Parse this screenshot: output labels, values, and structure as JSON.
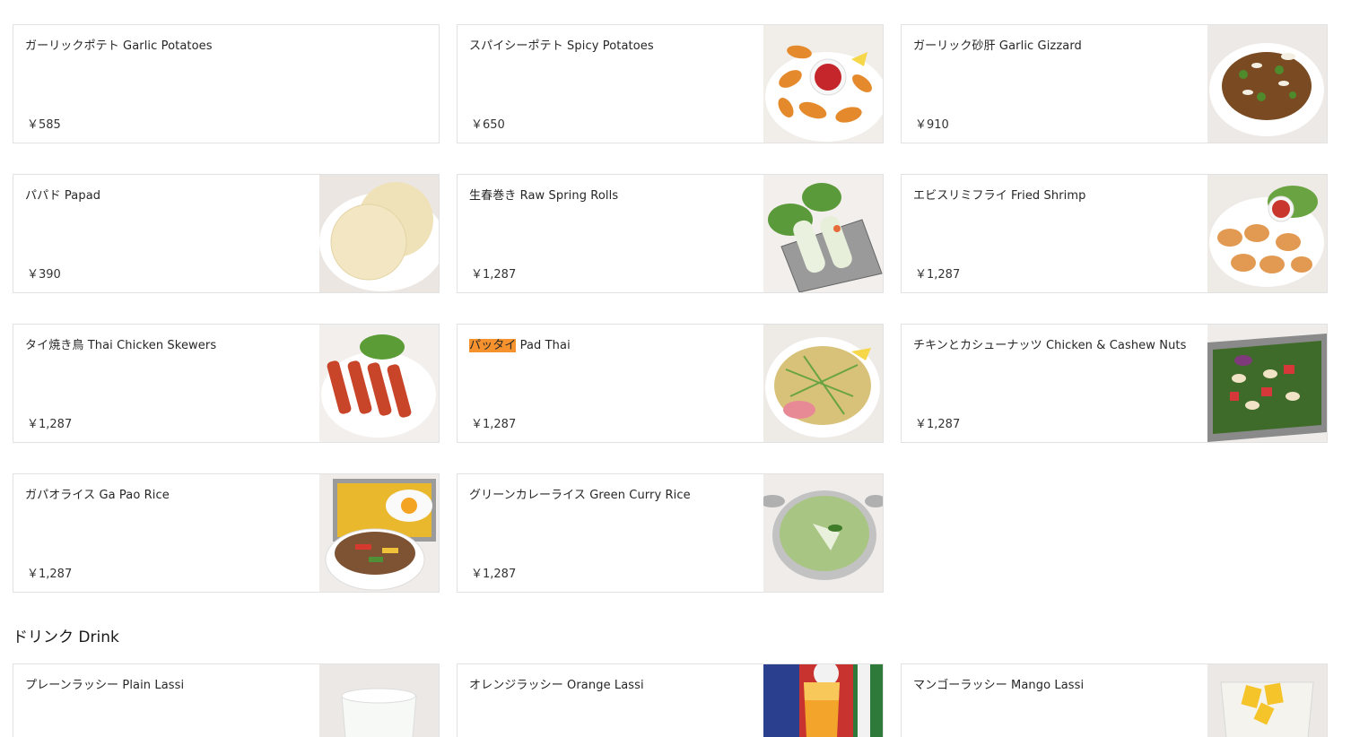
{
  "food_items": [
    {
      "name": "ガーリックポテト Garlic Potatoes",
      "price": "￥585",
      "photo": "none"
    },
    {
      "name": "スパイシーポテト Spicy Potatoes",
      "price": "￥650",
      "photo": "spicy-potatoes"
    },
    {
      "name": "ガーリック砂肝 Garlic Gizzard",
      "price": "￥910",
      "photo": "garlic-gizzard"
    },
    {
      "name": "パパド Papad",
      "price": "￥390",
      "photo": "papad"
    },
    {
      "name": "生春巻き Raw Spring Rolls",
      "price": "￥1,287",
      "photo": "spring-rolls"
    },
    {
      "name": "エビスリミフライ Fried Shrimp",
      "price": "￥1,287",
      "photo": "fried-shrimp"
    },
    {
      "name": "タイ焼き鳥 Thai Chicken Skewers",
      "price": "￥1,287",
      "photo": "chicken-skewers"
    },
    {
      "name_highlight": "パッタイ",
      "name_rest": " Pad Thai",
      "price": "￥1,287",
      "photo": "pad-thai"
    },
    {
      "name": "チキンとカシューナッツ Chicken & Cashew Nuts",
      "price": "￥1,287",
      "photo": "chicken-cashew"
    },
    {
      "name": "ガパオライス Ga Pao Rice",
      "price": "￥1,287",
      "photo": "gapao-rice"
    },
    {
      "name": "グリーンカレーライス Green Curry Rice",
      "price": "￥1,287",
      "photo": "green-curry"
    }
  ],
  "drink_section": {
    "title": "ドリンク Drink",
    "items": [
      {
        "name": "プレーンラッシー Plain Lassi",
        "photo": "plain-lassi"
      },
      {
        "name": "オレンジラッシー Orange Lassi",
        "photo": "orange-lassi"
      },
      {
        "name": "マンゴーラッシー Mango Lassi",
        "photo": "mango-lassi"
      }
    ]
  },
  "colors": {
    "highlight": "#f5922e",
    "border": "#e2e2e2",
    "text": "#262626"
  }
}
